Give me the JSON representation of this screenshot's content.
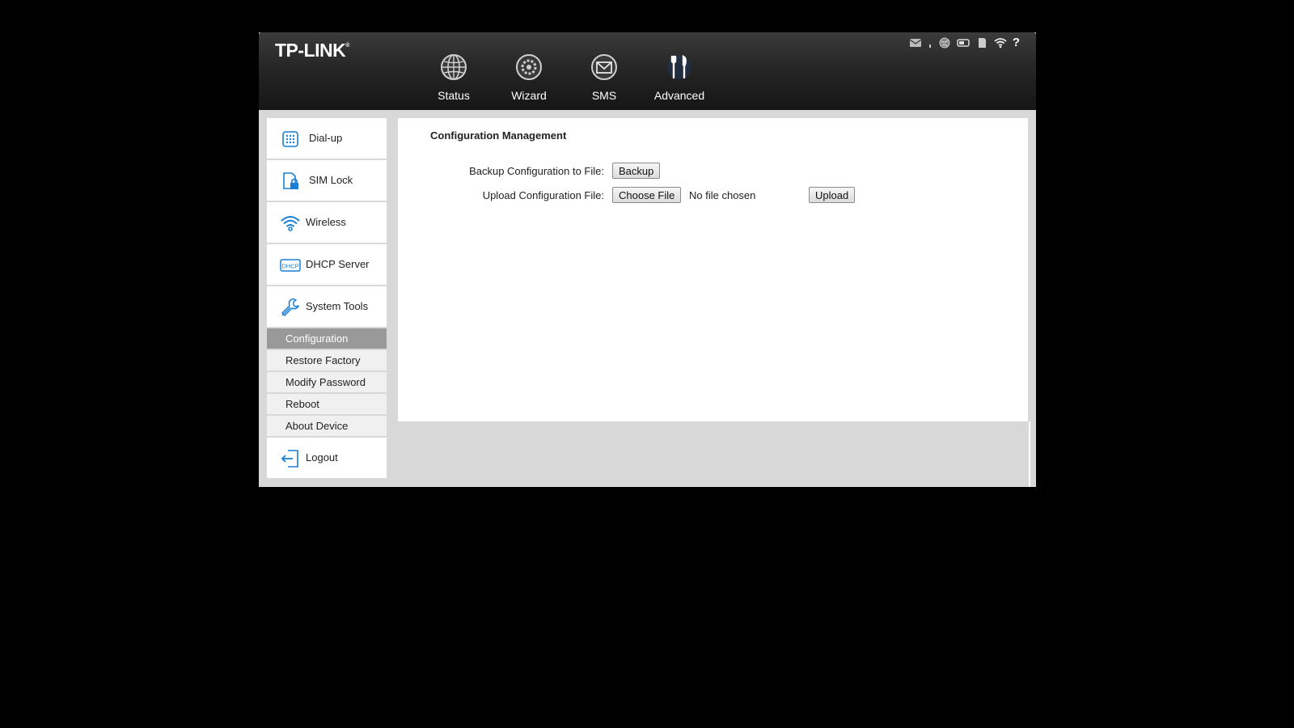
{
  "brand": {
    "logo_text": "TP-LINK",
    "logo_mark": "®"
  },
  "top_nav": [
    {
      "label": "Status",
      "icon": "globe-icon"
    },
    {
      "label": "Wizard",
      "icon": "gear-icon"
    },
    {
      "label": "SMS",
      "icon": "envelope-icon"
    },
    {
      "label": "Advanced",
      "icon": "tools-icon",
      "active": true
    }
  ],
  "status_bar": {
    "icons": [
      "mail-icon",
      "signal-icon",
      "internet-icon",
      "toggle-icon",
      "sim-card-icon",
      "wifi-icon",
      "help-icon"
    ],
    "help_label": "?"
  },
  "sidebar": {
    "items": [
      {
        "label": "Dial-up",
        "icon": "dialpad-icon"
      },
      {
        "label": "SIM Lock",
        "icon": "sim-lock-icon"
      },
      {
        "label": "Wireless",
        "icon": "wifi-icon"
      },
      {
        "label": "DHCP Server",
        "icon": "dhcp-icon"
      },
      {
        "label": "System Tools",
        "icon": "wrench-icon"
      }
    ],
    "subitems": [
      {
        "label": "Configuration",
        "active": true
      },
      {
        "label": "Restore Factory"
      },
      {
        "label": "Modify Password"
      },
      {
        "label": "Reboot"
      },
      {
        "label": "About Device"
      }
    ],
    "logout": {
      "label": "Logout",
      "icon": "logout-icon"
    }
  },
  "main": {
    "title": "Configuration Management",
    "backup_label": "Backup Configuration to File:",
    "backup_button": "Backup",
    "upload_label": "Upload Configuration File:",
    "choose_file_button": "Choose File",
    "file_status": "No file chosen",
    "upload_button": "Upload"
  },
  "colors": {
    "accent_blue": "#1a7fd4",
    "header_dark": "#1e1e1e",
    "active_subitem": "#999999"
  }
}
